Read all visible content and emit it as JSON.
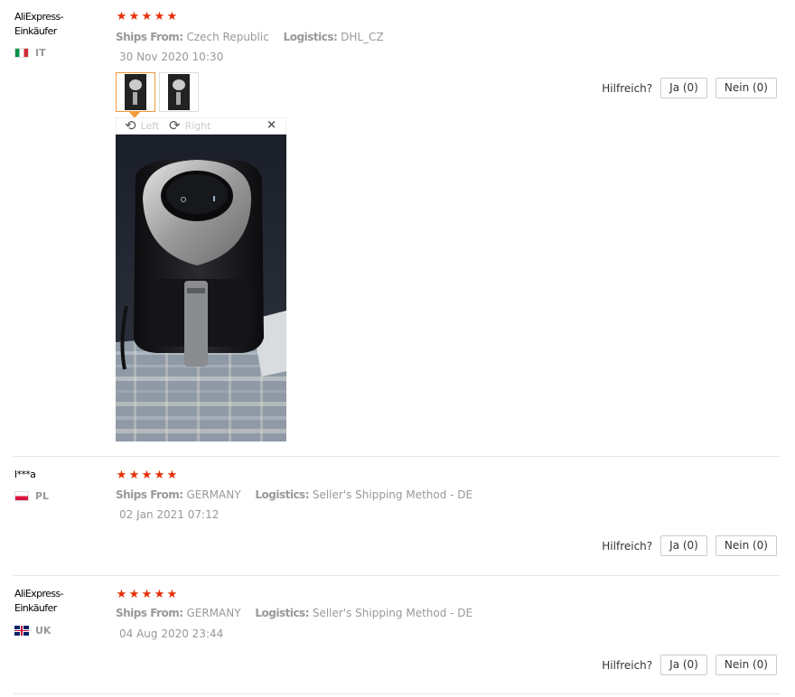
{
  "helpful_label": "Hilfreich?",
  "image_viewer": {
    "rotate_left": "Left",
    "rotate_right": "Right",
    "close": "×"
  },
  "reviews": [
    {
      "user": "AliExpress-Einkäufer",
      "country_code": "IT",
      "rating": 5,
      "ships_from_label": "Ships From:",
      "ships_from": "Czech Republic",
      "logistics_label": "Logistics:",
      "logistics": "DHL_CZ",
      "date": "30 Nov 2020 10:30",
      "yes_label": "Ja (0)",
      "no_label": "Nein (0)"
    },
    {
      "user": "l***a",
      "country_code": "PL",
      "rating": 5,
      "ships_from_label": "Ships From:",
      "ships_from": "GERMANY",
      "logistics_label": "Logistics:",
      "logistics": "Seller's Shipping Method - DE",
      "date": "02 Jan 2021 07:12",
      "yes_label": "Ja (0)",
      "no_label": "Nein (0)"
    },
    {
      "user": "AliExpress-Einkäufer",
      "country_code": "UK",
      "rating": 5,
      "ships_from_label": "Ships From:",
      "ships_from": "GERMANY",
      "logistics_label": "Logistics:",
      "logistics": "Seller's Shipping Method - DE",
      "date": "04 Aug 2020 23:44",
      "yes_label": "Ja (0)",
      "no_label": "Nein (0)"
    }
  ],
  "colors": {
    "star": "#e62e04",
    "active_thumb_border": "#f29a3c",
    "divider": "#e6e6e6"
  }
}
